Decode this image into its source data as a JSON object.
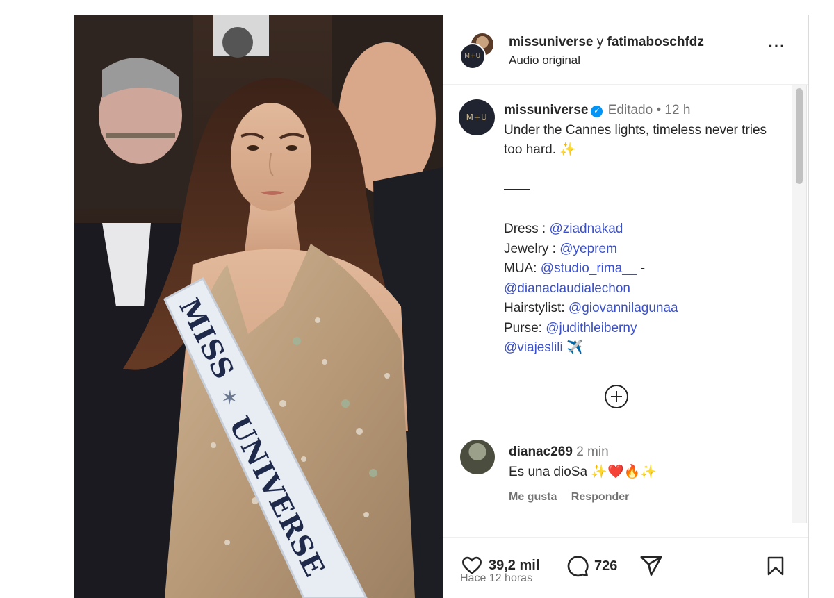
{
  "post": {
    "header": {
      "user1": "missuniverse",
      "conj": "y",
      "user2": "fatimaboschfdz",
      "audio": "Audio original",
      "more_icon": "more-horizontal-icon",
      "logo_text": "M+U"
    },
    "photo": {
      "sash_word1": "MISS",
      "sash_word2": "UNIVERSE",
      "description_icon": "photo"
    },
    "caption": {
      "username": "missuniverse",
      "edited": "Editado",
      "dot": "•",
      "time": "12 h",
      "text": "Under the Cannes lights, timeless never tries too hard. ✨",
      "dress_label": "Dress :",
      "dress_link": "@ziadnakad",
      "jewelry_label": "Jewelry :",
      "jewelry_link": "@yeprem",
      "mua_label": "MUA:",
      "mua_link1": "@studio_rima__",
      "mua_dash": "-",
      "mua_link2": "@dianaclaudialechon",
      "hair_label": "Hairstylist:",
      "hair_link": "@giovannilagunaa",
      "purse_label": "Purse:",
      "purse_link": "@judithleiberny",
      "travel_link": "@viajeslili",
      "travel_emoji": "✈️"
    },
    "comment": {
      "username": "dianac269",
      "time": "2 min",
      "text": "Es una dioSa ✨❤️🔥✨",
      "like_label": "Me gusta",
      "reply_label": "Responder"
    },
    "actions": {
      "likes": "39,2 mil",
      "comments": "726",
      "posted": "Hace 12 horas",
      "like_icon": "heart-icon",
      "comment_icon": "comment-icon",
      "share_icon": "send-icon",
      "save_icon": "bookmark-icon"
    }
  },
  "colors": {
    "link": "#3b50c6",
    "verified": "#0095f6",
    "muted": "#737373",
    "text": "#262626"
  }
}
